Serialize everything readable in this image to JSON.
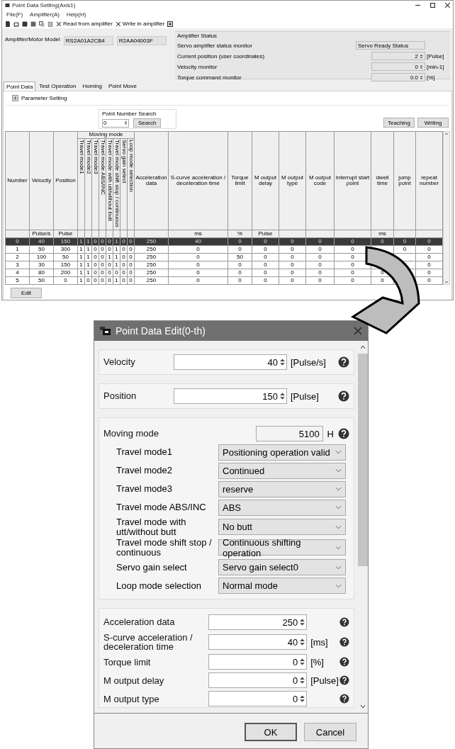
{
  "window": {
    "title": "Point Data Setting(Axis1)",
    "menu": [
      "File(F)",
      "Amplifier(A)",
      "Help(H)"
    ],
    "toolbar": [
      "Read from amplifier",
      "Write in amplifier"
    ]
  },
  "model": {
    "label": "Amplifier/Motor Model",
    "values": [
      "RS2A01A2CB4",
      "R2AA04003F"
    ]
  },
  "amplifier_status": {
    "title": "Amplifier Status",
    "rows": [
      {
        "kind": "text",
        "label": "Servo amplifier status monitor",
        "value": "Servo Ready Status"
      },
      {
        "kind": "spin",
        "label": "Current position (user coordinates)",
        "value": "2",
        "unit": "[Pulse]"
      },
      {
        "kind": "spin",
        "label": "Velocity monitor",
        "value": "0",
        "unit": "[min-1]"
      },
      {
        "kind": "spin",
        "label": "Torque command monitor",
        "value": "0.0",
        "unit": "[%]"
      }
    ]
  },
  "tabs": [
    {
      "label": "Point Data",
      "selected": true
    },
    {
      "label": "Test Operation",
      "selected": false
    },
    {
      "label": "Homing",
      "selected": false
    },
    {
      "label": "Point Move",
      "selected": false
    }
  ],
  "parameter_setting": "Parameter Setting",
  "search": {
    "title": "Point Number Search",
    "value": "0",
    "button": "Search"
  },
  "action_buttons": [
    "Teaching",
    "Writing"
  ],
  "table": {
    "group": "Moving mode",
    "columns": [
      {
        "kind": "plain",
        "label": "Number"
      },
      {
        "kind": "plain",
        "label": "Velocity",
        "unit": "Pulse/s"
      },
      {
        "kind": "plain",
        "label": "Position",
        "unit": "Pulse"
      },
      {
        "kind": "mode",
        "label": "Travel mode1"
      },
      {
        "kind": "mode",
        "label": "Travel mode2"
      },
      {
        "kind": "mode",
        "label": "Travel mode3"
      },
      {
        "kind": "mode",
        "label": "Travel mode ABS/INC"
      },
      {
        "kind": "mode",
        "label": "Travel mode with utt/without butt"
      },
      {
        "kind": "mode",
        "label": "Travel mode shift stop / continuous"
      },
      {
        "kind": "mode",
        "label": "Servo gain select"
      },
      {
        "kind": "mode",
        "label": "Loop mode selection"
      },
      {
        "kind": "plain",
        "label": "Acceleration data"
      },
      {
        "kind": "plain",
        "label": "S-curve acceleration / deceleration time",
        "unit": "ms"
      },
      {
        "kind": "plain",
        "label": "Torque limit",
        "unit": "%"
      },
      {
        "kind": "plain",
        "label": "M output delay",
        "unit": "Pulse"
      },
      {
        "kind": "plain",
        "label": "M output type"
      },
      {
        "kind": "plain",
        "label": "M output code"
      },
      {
        "kind": "plain",
        "label": "Interrupt start point"
      },
      {
        "kind": "plain",
        "label": "dwell time",
        "unit": "ms"
      },
      {
        "kind": "plain",
        "label": "jump point"
      },
      {
        "kind": "plain",
        "label": "repeat number"
      }
    ],
    "rows": [
      {
        "selected": true,
        "cells": [
          "0",
          "40",
          "150",
          "1",
          "1",
          "0",
          "0",
          "0",
          "1",
          "0",
          "0",
          "250",
          "40",
          "0",
          "0",
          "0",
          "0",
          "0",
          "0",
          "0",
          "0"
        ]
      },
      {
        "selected": false,
        "cells": [
          "1",
          "50",
          "300",
          "1",
          "1",
          "0",
          "0",
          "0",
          "1",
          "0",
          "0",
          "250",
          "0",
          "0",
          "0",
          "0",
          "0",
          "0",
          null,
          "0",
          "0"
        ]
      },
      {
        "selected": false,
        "cells": [
          "2",
          "100",
          "50",
          "1",
          "1",
          "0",
          "0",
          "1",
          "1",
          "0",
          "0",
          "250",
          "0",
          "50",
          "0",
          "0",
          "0",
          "0",
          null,
          null,
          "0"
        ]
      },
      {
        "selected": false,
        "cells": [
          "3",
          "30",
          "150",
          "1",
          "1",
          "0",
          "0",
          "0",
          "1",
          "0",
          "0",
          "250",
          "0",
          "0",
          "0",
          "0",
          "0",
          "0",
          null,
          null,
          "0"
        ]
      },
      {
        "selected": false,
        "cells": [
          "4",
          "80",
          "200",
          "1",
          "1",
          "0",
          "0",
          "0",
          "0",
          "0",
          "0",
          "250",
          "0",
          "0",
          "0",
          "0",
          "0",
          "0",
          "0",
          null,
          "0"
        ]
      },
      {
        "selected": false,
        "cells": [
          "5",
          "50",
          "0",
          "1",
          "0",
          "0",
          "0",
          "0",
          "1",
          "0",
          "0",
          "250",
          "0",
          "0",
          "0",
          "0",
          "0",
          "0",
          "0",
          null,
          "0"
        ]
      }
    ]
  },
  "edit_button": "Edit",
  "dialog": {
    "title": "Point Data Edit(0-th)",
    "sections": [
      {
        "rows": [
          {
            "kind": "spin",
            "label": "Velocity",
            "value": "40",
            "unit": "[Pulse/s]"
          }
        ]
      },
      {
        "rows": [
          {
            "kind": "spin",
            "label": "Position",
            "value": "150",
            "unit": "[Pulse]"
          }
        ]
      },
      {
        "rows": [
          {
            "kind": "hex",
            "label": "Moving mode",
            "value": "5100",
            "unit": "H"
          },
          {
            "kind": "select",
            "label": "Travel mode1",
            "value": "Positioning operation valid"
          },
          {
            "kind": "select",
            "label": "Travel mode2",
            "value": "Continued"
          },
          {
            "kind": "select",
            "label": "Travel mode3",
            "value": "reserve"
          },
          {
            "kind": "select",
            "label": "Travel  mode ABS/INC",
            "value": "ABS"
          },
          {
            "kind": "select",
            "label": "Travel mode with utt/without butt",
            "value": "No butt"
          },
          {
            "kind": "select",
            "label": "Travel mode shift stop / continuous",
            "value": "Continuous shifting operation"
          },
          {
            "kind": "select",
            "label": "Servo gain select",
            "value": "Servo gain select0"
          },
          {
            "kind": "select",
            "label": "Loop mode selection",
            "value": "Normal mode"
          }
        ]
      },
      {
        "rows": [
          {
            "kind": "spin",
            "label": "Acceleration data",
            "value": "250"
          },
          {
            "kind": "spin",
            "label": "S-curve acceleration / deceleration time",
            "value": "40",
            "unit": "[ms]"
          },
          {
            "kind": "spin",
            "label": "Torque limit",
            "value": "0",
            "unit": "[%]"
          },
          {
            "kind": "spin",
            "label": "M output delay",
            "value": "0",
            "unit": "[Pulse]"
          },
          {
            "kind": "spin",
            "label": "M output type",
            "value": "0"
          }
        ]
      }
    ],
    "buttons": [
      {
        "label": "OK",
        "default": true
      },
      {
        "label": "Cancel",
        "default": false
      }
    ]
  }
}
